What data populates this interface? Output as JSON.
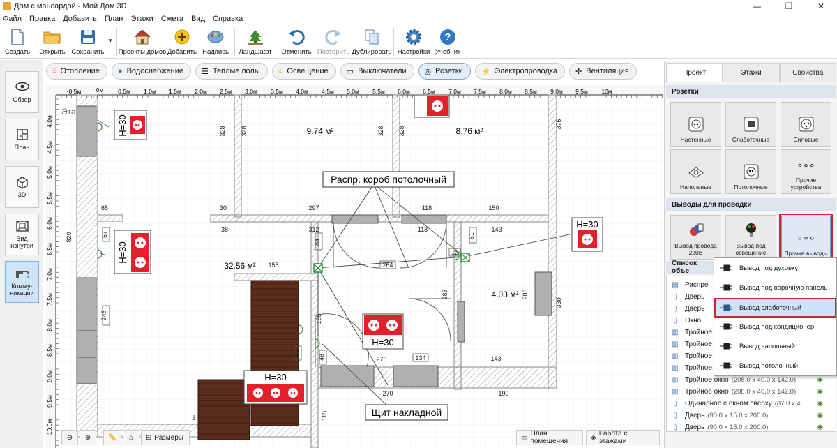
{
  "window": {
    "title": "Дом с мансардой - Мой Дом 3D",
    "controls": [
      "—",
      "❐",
      "✕"
    ]
  },
  "menu": [
    "Файл",
    "Правка",
    "Добавить",
    "План",
    "Этажи",
    "Смета",
    "Вид",
    "Справка"
  ],
  "toolbar": {
    "create": "Создать",
    "open": "Открыть",
    "save": "Сохранить",
    "projects": "Проекты домов",
    "add": "Добавить",
    "caption": "Надпись",
    "landscape": "Ландшафт",
    "undo": "Отменить",
    "redo": "Повторить",
    "duplicate": "Дублировать",
    "settings": "Настройки",
    "tutorial": "Учебник"
  },
  "left_nav": {
    "overview": "Обзор",
    "plan": "План",
    "view3d": "3D",
    "inside": "Вид изнутри",
    "comms": "Комму-никации"
  },
  "categories": [
    {
      "label": "Отопление",
      "icon": "heating-icon"
    },
    {
      "label": "Водоснабжение",
      "icon": "water-drop-icon"
    },
    {
      "label": "Теплые полы",
      "icon": "heated-floor-icon"
    },
    {
      "label": "Освещение",
      "icon": "bulb-icon"
    },
    {
      "label": "Выключатели",
      "icon": "switch-icon"
    },
    {
      "label": "Розетки",
      "icon": "socket-icon"
    },
    {
      "label": "Электропроводка",
      "icon": "lightning-icon"
    },
    {
      "label": "Вентиляция",
      "icon": "fan-icon"
    }
  ],
  "plan": {
    "floor_label": "Этаж №1",
    "ruler_top": [
      "-0.5м",
      "0м",
      "0.5м",
      "1.0м",
      "1.5м",
      "2.0м",
      "2.5м",
      "3.0м",
      "3.5м",
      "4.0м",
      "4.5м",
      "5.0м",
      "5.5м",
      "6.0м",
      "6.5м",
      "7.0м",
      "7.5м",
      "8.0м",
      "8.5м",
      "9.0м",
      "9.5м",
      "10м"
    ],
    "ruler_left": [
      "4.0м",
      "4.5м",
      "5.0м",
      "5.5м",
      "6.0м",
      "6.5м",
      "7.0м",
      "7.5м",
      "8.0м",
      "8.5м",
      "9.0м",
      "9.5м",
      "10.0м"
    ],
    "rooms": {
      "room_a": "9.74 м²",
      "room_b": "8.76 м²",
      "room_c": "32.56 м²",
      "room_d": "4.03 м²"
    },
    "dims": {
      "d328a": "328",
      "d328b": "328",
      "d328c": "328",
      "d328d": "328",
      "d375": "375",
      "d65": "65",
      "d30": "30",
      "d297": "297",
      "d118a": "118",
      "d150": "150",
      "d38": "38",
      "d312": "312",
      "d118b": "118",
      "d143a": "143",
      "d820": "820",
      "d57": "57",
      "d84": "84",
      "d155": "155",
      "d264": "264",
      "d12": "12",
      "d61": "61",
      "d283a": "283",
      "d283b": "283",
      "d330": "330",
      "d245": "245",
      "d185": "185",
      "d65b": "65",
      "d48": "48",
      "d275": "275",
      "d134": "134",
      "d143b": "143",
      "d270": "270",
      "d190": "190",
      "d115": "115",
      "d3": "3"
    },
    "callouts": {
      "ceiling_box": "Распр. короб потолочный",
      "panel": "Щит накладной"
    },
    "socket_labels": {
      "s1": "H=30",
      "s2": "H=30",
      "s3": "H=30",
      "s4": "H=30",
      "s5": "H=30"
    },
    "bottom": {
      "sizes": "Размеры",
      "room_plan": "План помещения",
      "floors_work": "Работа с этажами"
    }
  },
  "right_panel": {
    "tabs": [
      "Проект",
      "Этажи",
      "Свойства"
    ],
    "sockets_title": "Розетки",
    "sockets": [
      "Настенные",
      "Слаботочные",
      "Силовые",
      "Напольные",
      "Потолочные",
      "Прочие устройства"
    ],
    "outputs_title": "Выводы для проводки",
    "outputs": [
      "Вывод провода 220В",
      "Вывод под освещение",
      "Прочие выводы"
    ],
    "objects_title": "Список объе",
    "objects": [
      {
        "name": "Распре",
        "dims": ""
      },
      {
        "name": "Дверь",
        "dims": ""
      },
      {
        "name": "Дверь",
        "dims": ""
      },
      {
        "name": "Окно",
        "dims": ""
      },
      {
        "name": "Тройное",
        "dims": ""
      },
      {
        "name": "Тройное",
        "dims": ""
      },
      {
        "name": "Тройное",
        "dims": ""
      },
      {
        "name": "Тройное",
        "dims": ""
      },
      {
        "name": "Тройное окно",
        "dims": "(208.0 x 40.0 x 142.0)"
      },
      {
        "name": "Тройное окно",
        "dims": "(208.0 x 40.0 x 142.0)"
      },
      {
        "name": "Одинарное с окном сверху",
        "dims": "(87.0 x 4..."
      },
      {
        "name": "Дверь",
        "dims": "(90.0 x 15.0 x 200.0)"
      },
      {
        "name": "Дверь",
        "dims": "(90.0 x 15.0 x 200.0)"
      }
    ]
  },
  "dropdown": [
    "Вывод под духовку",
    "Вывод под варочную панель",
    "Вывод слаботочный",
    "Вывод под кондиционер",
    "Вывод напольный",
    "Вывод потолочный"
  ],
  "colors": {
    "socket_red": "#e4202a",
    "highlight_red": "#d0242c",
    "selection_blue": "#cde3f7"
  }
}
